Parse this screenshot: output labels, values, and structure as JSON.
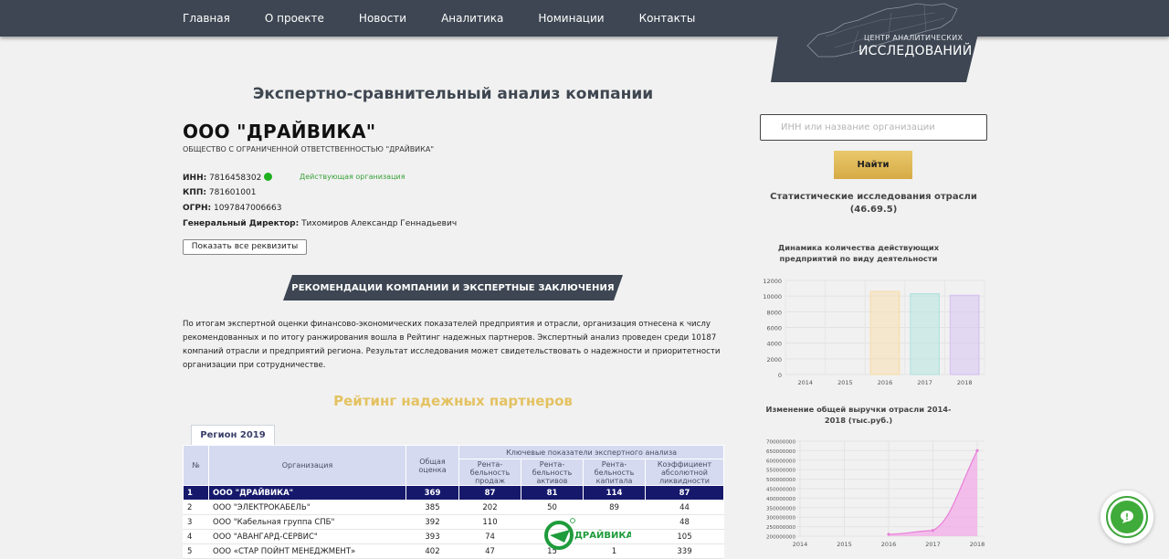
{
  "nav": {
    "items": [
      "Главная",
      "О проекте",
      "Новости",
      "Аналитика",
      "Номинации",
      "Контакты"
    ],
    "logo_line1": "ЦЕНТР АНАЛИТИЧЕСКИХ",
    "logo_line2": "ИССЛЕДОВАНИЙ"
  },
  "page": {
    "title": "Экспертно-сравнительный анализ компании"
  },
  "company": {
    "name": "ООО \"ДРАЙВИКА\"",
    "full_name": "ОБЩЕСТВО С ОГРАНИЧЕННОЙ ОТВЕТСТВЕННОСТЬЮ \"ДРАЙВИКА\"",
    "inn_label": "ИНН:",
    "inn": "7816458302",
    "status": "Действующая организация",
    "kpp_label": "КПП:",
    "kpp": "781601001",
    "ogrn_label": "ОГРН:",
    "ogrn": "1097847006663",
    "director_label": "Генеральный Директор:",
    "director": "Тихомиров Александр Геннадьевич",
    "show_all_button": "Показать все реквизиты"
  },
  "recommendations": {
    "banner": "РЕКОМЕНДАЦИИ КОМПАНИИ И ЭКСПЕРТНЫЕ ЗАКЛЮЧЕНИЯ",
    "paragraph": "По итогам экспертной оценки финансово-экономических показателей предприятия и отрасли, организация отнесена к числу рекомендованных и по итогу ранжирования вошла в Рейтинг надежных партнеров. Экспертный анализ проведен среди 10187 компаний отрасли и предприятий региона. Результат исследования может свидетельствовать о надежности и приоритетности организации при сотрудничестве."
  },
  "rating": {
    "heading": "Рейтинг надежных партнеров",
    "tab": "Регион 2019 год",
    "headers": {
      "num": "№",
      "org": "Организация",
      "score": "Общая оценка",
      "group": "Ключевые показатели экспертного анализа",
      "k1": "Рента-бельность продаж",
      "k2": "Рента-бельность активов",
      "k3": "Рента-бельность капитала",
      "k4": "Коэффициент абсолютной ликвидности"
    },
    "rows": [
      [
        "1",
        "ООО \"ДРАЙВИКА\"",
        "369",
        "87",
        "81",
        "114",
        "87"
      ],
      [
        "2",
        "ООО \"ЭЛЕКТРОКАБЕЛЬ\"",
        "385",
        "202",
        "50",
        "89",
        "44"
      ],
      [
        "3",
        "ООО \"Кабельная группа СПБ\"",
        "392",
        "110",
        "",
        "",
        "48"
      ],
      [
        "4",
        "ООО \"АВАНГАРД-СЕРВИС\"",
        "393",
        "74",
        "",
        "",
        "105"
      ],
      [
        "5",
        "ООО «СТАР ПОЙНТ МЕНЕДЖМЕНТ»",
        "402",
        "47",
        "15",
        "1",
        "339"
      ]
    ],
    "watermark": "ДРАЙВИКА"
  },
  "sidebar": {
    "search_placeholder": "ИНН или название организации",
    "find_button": "Найти",
    "stat_title": "Статистические исследования отрасли (46.69.5)"
  },
  "chart_data": [
    {
      "type": "bar",
      "title": "Динамика количества действующих предприятий по виду деятельности",
      "categories": [
        "2014",
        "2015",
        "2016",
        "2017",
        "2018"
      ],
      "values": [
        0,
        0,
        10600,
        10300,
        10100
      ],
      "ylim": [
        0,
        12000
      ],
      "yticks": [
        "12000",
        "10000",
        "8000",
        "6000",
        "4000",
        "2000",
        "0"
      ],
      "colors": [
        "#f4dba3",
        "#f4dba3",
        "#f7dfae",
        "#b5e3e0",
        "#d6c3f2"
      ]
    },
    {
      "type": "area",
      "title": "Изменение общей выручки отрасли 2014-2018 (тыс.руб.)",
      "categories": [
        "2014",
        "2015",
        "2016",
        "2017",
        "2018"
      ],
      "values": [
        null,
        null,
        210000000,
        230000000,
        650000000
      ],
      "ylim": [
        200000000,
        700000000
      ],
      "yticks": [
        "700000000",
        "650000000",
        "600000000",
        "550000000",
        "500000000",
        "450000000",
        "400000000",
        "350000000",
        "300000000",
        "250000000",
        "200000000"
      ],
      "color": "#f3a6e8"
    }
  ]
}
